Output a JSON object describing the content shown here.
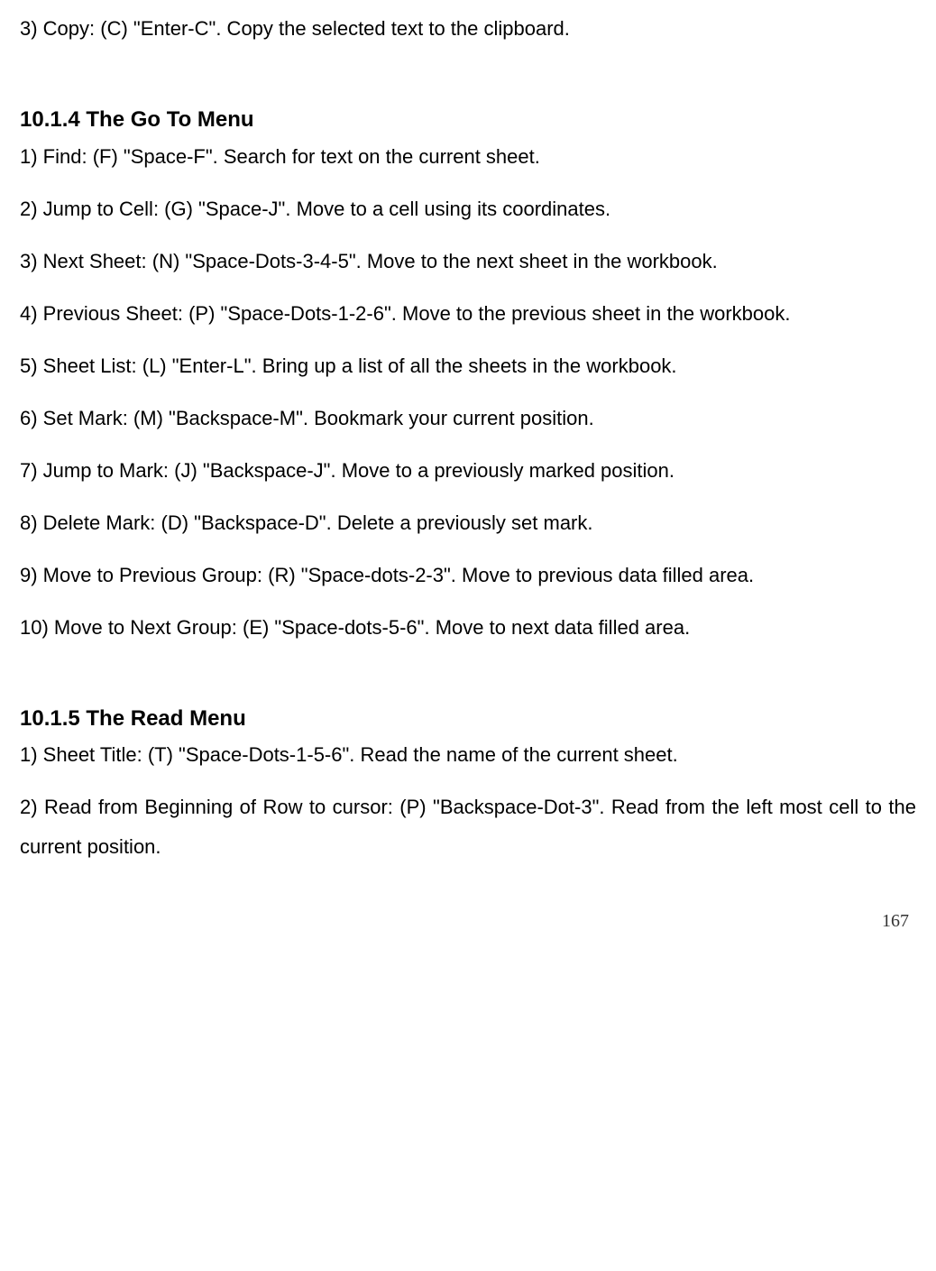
{
  "intro_item": "3) Copy: (C) \"Enter-C\". Copy the selected text to the clipboard.",
  "sections": [
    {
      "heading": "10.1.4 The Go To Menu",
      "items": [
        "1) Find: (F) \"Space-F\". Search for text on the current sheet.",
        "2) Jump to Cell: (G) \"Space-J\". Move to a cell using its coordinates.",
        "3) Next Sheet: (N) \"Space-Dots-3-4-5\". Move to the next sheet in the workbook.",
        "4) Previous Sheet: (P) \"Space-Dots-1-2-6\". Move to the previous sheet in the workbook.",
        "5) Sheet List: (L) \"Enter-L\". Bring up a list of all the sheets in the workbook.",
        "6) Set Mark: (M) \"Backspace-M\". Bookmark your current position.",
        "7) Jump to Mark: (J) \"Backspace-J\". Move to a previously marked position.",
        "8) Delete Mark: (D) \"Backspace-D\". Delete a previously set mark.",
        "9) Move to Previous Group: (R) \"Space-dots-2-3\". Move to previous data filled area.",
        "10) Move to Next Group: (E) \"Space-dots-5-6\". Move to next data filled area."
      ]
    },
    {
      "heading": "10.1.5 The Read Menu",
      "items": [
        "1) Sheet Title: (T) \"Space-Dots-1-5-6\". Read the name of the current sheet.",
        "2) Read from Beginning of Row to cursor: (P) \"Backspace-Dot-3\". Read from the left most cell to the current position."
      ]
    }
  ],
  "page_number": "167"
}
